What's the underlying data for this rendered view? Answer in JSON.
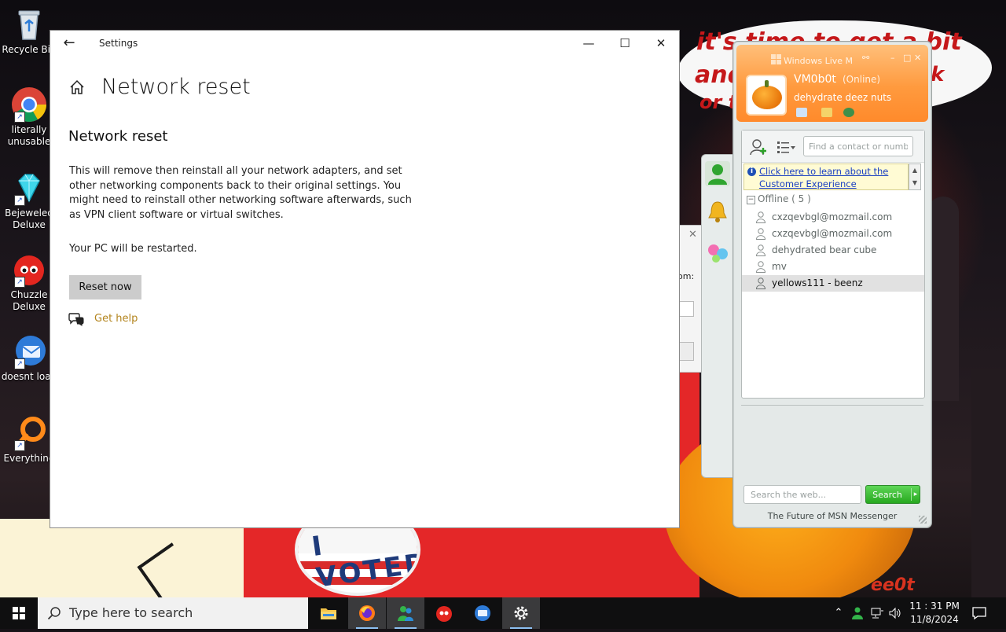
{
  "desktop": {
    "icons": [
      {
        "label": "Recycle Bin",
        "icon": "recycle-bin-icon"
      },
      {
        "label": "literally unusable",
        "icon": "chrome-icon"
      },
      {
        "label": "Bejeweled Deluxe",
        "icon": "diamond-icon"
      },
      {
        "label": "Chuzzle Deluxe",
        "icon": "chuzzle-icon"
      },
      {
        "label": "doesnt load",
        "icon": "thunderbird-icon"
      },
      {
        "label": "Everything",
        "icon": "magnifier-icon"
      }
    ],
    "wallpaper": {
      "speech_line1": "it's time to get a bit",
      "speech_line2": "and",
      "speech_line3": "or t",
      "speech_right": "k",
      "button_text": "I VOTED",
      "bottom_text": "ee0t"
    }
  },
  "settings": {
    "app_title": "Settings",
    "page_title": "Network reset",
    "section_title": "Network reset",
    "description": "This will remove then reinstall all your network adapters, and set other networking components back to their original settings. You might need to reinstall other networking software afterwards, such as VPN client software or virtual switches.",
    "restart_note": "Your PC will be restarted.",
    "reset_button": "Reset now",
    "help_link": "Get help"
  },
  "background_dialog": {
    "fragment": "om:"
  },
  "messenger": {
    "window_title": "Windows Live M",
    "username": "VM0b0t",
    "status": "(Online)",
    "personal_message": "dehydrate deez nuts",
    "find_placeholder": "Find a contact or number",
    "notice": "Click here to learn about the Customer Experience",
    "group_label": "Offline ( 5 )",
    "contacts": [
      {
        "name": "cxzqevbgl@mozmail.com"
      },
      {
        "name": "cxzqevbgl@mozmail.com"
      },
      {
        "name": "dehydrated bear cube"
      },
      {
        "name": "mv"
      },
      {
        "name": "yellows111 - beenz",
        "selected": true
      }
    ],
    "web_search_placeholder": "Search the web...",
    "search_button": "Search",
    "footer": "The Future of MSN Messenger",
    "accent_color": "#ff9a3e"
  },
  "taskbar": {
    "search_placeholder": "Type here to search",
    "apps": [
      "file-explorer-icon",
      "firefox-icon",
      "messenger-icon",
      "chuzzle-icon",
      "thunderbird-icon",
      "settings-gear-icon"
    ],
    "active_app": "settings-gear-icon",
    "time": "11 : 31 PM",
    "date": "11/8/2024"
  }
}
